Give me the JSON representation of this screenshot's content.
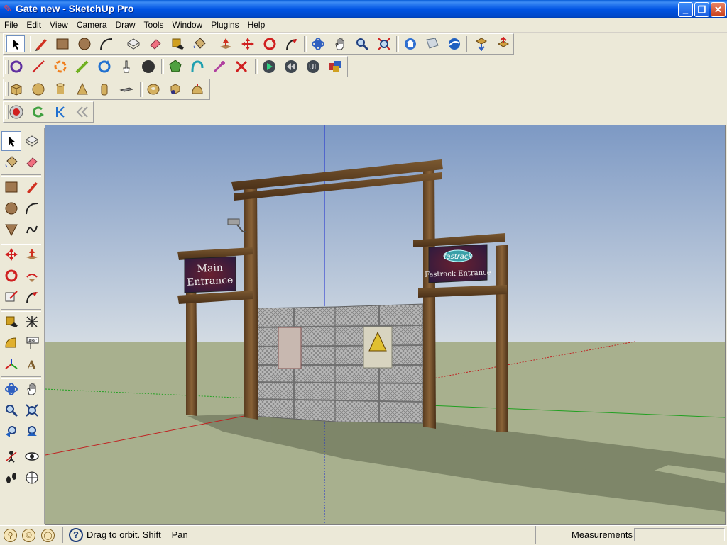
{
  "window": {
    "title": "Gate new - SketchUp Pro",
    "controls": [
      "minimize",
      "maximize",
      "close"
    ]
  },
  "menu": [
    "File",
    "Edit",
    "View",
    "Camera",
    "Draw",
    "Tools",
    "Window",
    "Plugins",
    "Help"
  ],
  "toolbars": {
    "main": [
      "select-icon",
      "pencil-icon",
      "rectangle-icon",
      "circle-icon",
      "arc-icon",
      "make-component-icon",
      "eraser-icon",
      "tape-measure-icon",
      "paint-bucket-icon",
      "push-pull-icon",
      "move-icon",
      "rotate-icon",
      "follow-me-icon",
      "orbit-icon",
      "pan-icon",
      "zoom-icon",
      "zoom-extents-icon",
      "get-models-icon",
      "share-model-icon",
      "google-earth-icon",
      "get-component-icon",
      "share-component-icon"
    ],
    "plugins": [
      "rotate-x-icon",
      "line-tool-icon",
      "rotate-orange-icon",
      "pen-tool-icon",
      "refresh-icon",
      "hand-pointer-icon",
      "black-circle-icon",
      "green-gem-icon",
      "cyan-curve-icon",
      "magnet-icon",
      "cross-icon",
      "play-icon",
      "rewind-icon",
      "ui-icon",
      "dice-icon"
    ],
    "solids": [
      "box-icon",
      "sphere-icon",
      "cylinder-icon",
      "cone-icon",
      "tube-icon",
      "plate-icon",
      "torus-icon",
      "helix-icon",
      "dome-icon"
    ],
    "animation": [
      "record-icon",
      "loop-icon",
      "skip-back-icon",
      "rewind-double-icon"
    ]
  },
  "left_tools": [
    "select-icon",
    "make-component-icon",
    "paint-bucket-icon",
    "eraser-icon",
    "rectangle-icon",
    "line-icon",
    "circle-icon",
    "arc-icon",
    "polygon-icon",
    "freehand-icon",
    "move-icon",
    "push-pull-icon",
    "rotate-icon",
    "follow-me-icon",
    "scale-icon",
    "offset-icon",
    "tape-measure-icon",
    "dimension-icon",
    "protractor-icon",
    "text-icon",
    "axes-icon",
    "3d-text-icon",
    "orbit-icon",
    "pan-icon",
    "zoom-icon",
    "zoom-window-icon",
    "previous-view-icon",
    "zoom-extents-icon",
    "position-camera-icon",
    "look-around-icon",
    "walk-icon",
    "section-plane-icon"
  ],
  "scene": {
    "left_sign": [
      "Main",
      "Entrance"
    ],
    "right_sign_logo": "fastrack",
    "right_sign": "Fastrack Entrance",
    "sky_top": "#7d99c4",
    "sky_bottom": "#d3dbe3",
    "ground": "#a8b08e"
  },
  "status": {
    "icons": [
      "geo-location-icon",
      "credits-icon",
      "user-icon"
    ],
    "help_glyph": "?",
    "message": "Drag to orbit.  Shift = Pan",
    "measurements_label": "Measurements",
    "measurements_value": ""
  }
}
